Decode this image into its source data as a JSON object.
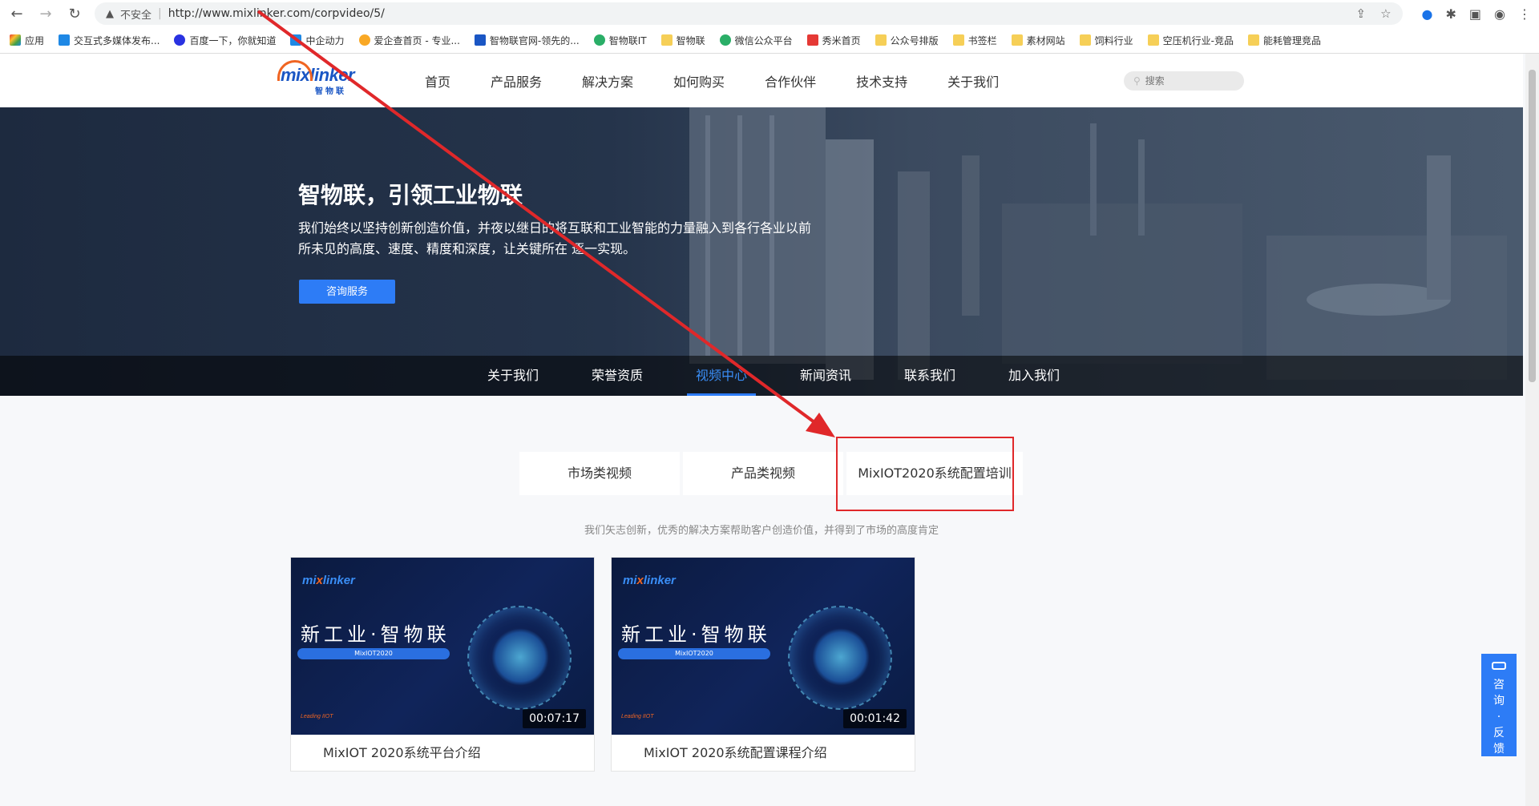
{
  "browser": {
    "security_label": "不安全",
    "url": "http://www.mixlinker.com/corpvideo/5/",
    "bookmarks": [
      "应用",
      "交互式多媒体发布...",
      "百度一下，你就知道",
      "中企动力",
      "爱企查首页 - 专业...",
      "智物联官网-领先的...",
      "智物联IT",
      "智物联",
      "微信公众平台",
      "秀米首页",
      "公众号排版",
      "书签栏",
      "素材网站",
      "饲料行业",
      "空压机行业-竞品",
      "能耗管理竞品"
    ]
  },
  "header": {
    "logo_text": "mixlinker",
    "logo_cn": "智物联",
    "nav": [
      "首页",
      "产品服务",
      "解决方案",
      "如何购买",
      "合作伙伴",
      "技术支持",
      "关于我们"
    ],
    "search_placeholder": "搜索"
  },
  "banner": {
    "title": "智物联，引领工业物联",
    "description": "我们始终以坚持创新创造价值，并夜以继日的将互联和工业智能的力量融入到各行各业以前所未见的高度、速度、精度和深度，让关键所在 逐一实现。",
    "cta": "咨询服务"
  },
  "subnav": {
    "items": [
      "关于我们",
      "荣誉资质",
      "视频中心",
      "新闻资讯",
      "联系我们",
      "加入我们"
    ],
    "active": "视频中心"
  },
  "video_tabs": [
    "市场类视频",
    "产品类视频",
    "MixIOT2020系统配置培训"
  ],
  "subtitle": "我们矢志创新，优秀的解决方案帮助客户创造价值，并得到了市场的高度肯定",
  "videos": [
    {
      "headline": "新工业·智物联",
      "pill": "MixIOT2020",
      "tag": "Leading IIOT",
      "duration": "00:07:17",
      "title": "MixIOT 2020系统平台介绍"
    },
    {
      "headline": "新工业·智物联",
      "pill": "MixIOT2020",
      "tag": "Leading IIOT",
      "duration": "00:01:42",
      "title": "MixIOT 2020系统配置课程介绍"
    }
  ],
  "float": {
    "chars": [
      "咨",
      "询",
      "·",
      "反",
      "馈"
    ]
  },
  "colors": {
    "brand_blue": "#2d7cf6",
    "brand_orange": "#f06522",
    "annotation_red": "#e0282a"
  }
}
